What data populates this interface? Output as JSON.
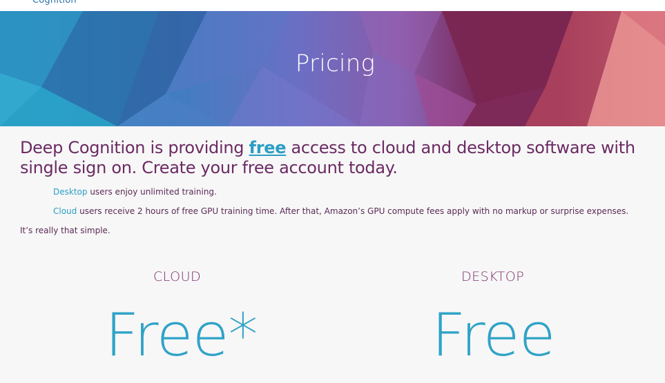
{
  "header": {
    "logo_text": "Cognition"
  },
  "banner": {
    "title": "Pricing"
  },
  "intro": {
    "headline_before": "Deep Cognition is providing ",
    "headline_link": "free",
    "headline_after": " access to cloud and desktop software with single sign on. Create your free account today.",
    "desktop_keyword": "Desktop",
    "desktop_text": " users enjoy unlimited training.",
    "cloud_keyword": "Cloud",
    "cloud_text": " users receive 2 hours of free GPU training time.  After that, Amazon’s GPU compute fees apply with no markup or surprise expenses.",
    "simple_text": "It’s really that simple."
  },
  "plans": [
    {
      "label": "CLOUD",
      "price": "Free*"
    },
    {
      "label": "DESKTOP",
      "price": "Free"
    }
  ],
  "colors": {
    "accent": "#2a9ec4",
    "headline": "#6b2a63",
    "plan_label": "#7a2f6e"
  }
}
